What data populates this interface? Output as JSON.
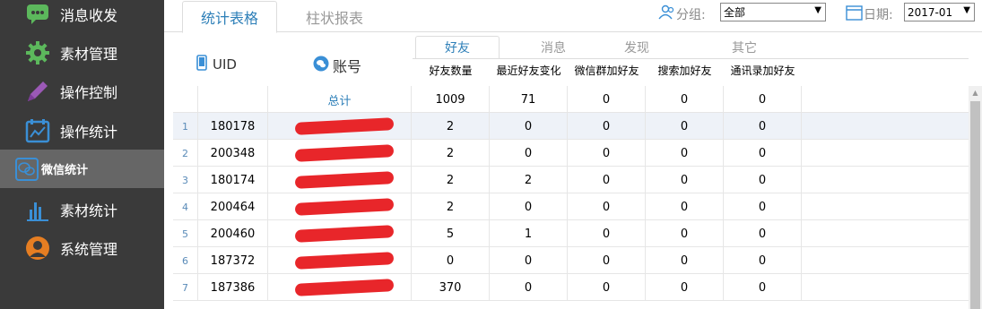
{
  "sidebar": {
    "items": [
      {
        "label": "消息收发",
        "icon": "chat-icon"
      },
      {
        "label": "素材管理",
        "icon": "gear-icon"
      },
      {
        "label": "操作控制",
        "icon": "pencil-icon"
      },
      {
        "label": "操作统计",
        "icon": "calendar-chart-icon"
      },
      {
        "label": "微信统计",
        "icon": "wechat-icon"
      },
      {
        "label": "素材统计",
        "icon": "bar-chart-icon"
      },
      {
        "label": "系统管理",
        "icon": "user-icon"
      }
    ]
  },
  "tabs": [
    {
      "label": "统计表格"
    },
    {
      "label": "柱状报表"
    }
  ],
  "filters": {
    "group_label": "分组:",
    "group_value": "全部",
    "date_label": "日期:",
    "date_value": "2017-01"
  },
  "header": {
    "uid_label": "UID",
    "account_label": "账号",
    "subtabs": [
      {
        "label": "好友"
      },
      {
        "label": "消息"
      },
      {
        "label": "发现"
      },
      {
        "label": "其它"
      }
    ],
    "columns": [
      "好友数量",
      "最近好友变化",
      "微信群加好友",
      "搜索加好友",
      "通讯录加好友"
    ]
  },
  "total": {
    "label": "总计",
    "values": [
      "1009",
      "71",
      "0",
      "0",
      "0"
    ]
  },
  "rows": [
    {
      "idx": "1",
      "uid": "180178",
      "values": [
        "2",
        "0",
        "0",
        "0",
        "0"
      ]
    },
    {
      "idx": "2",
      "uid": "200348",
      "values": [
        "2",
        "0",
        "0",
        "0",
        "0"
      ]
    },
    {
      "idx": "3",
      "uid": "180174",
      "values": [
        "2",
        "2",
        "0",
        "0",
        "0"
      ]
    },
    {
      "idx": "4",
      "uid": "200464",
      "values": [
        "2",
        "0",
        "0",
        "0",
        "0"
      ]
    },
    {
      "idx": "5",
      "uid": "200460",
      "values": [
        "5",
        "1",
        "0",
        "0",
        "0"
      ]
    },
    {
      "idx": "6",
      "uid": "187372",
      "values": [
        "0",
        "0",
        "0",
        "0",
        "0"
      ]
    },
    {
      "idx": "7",
      "uid": "187386",
      "values": [
        "370",
        "0",
        "0",
        "0",
        "0"
      ]
    }
  ],
  "colors": {
    "sidebar_bg": "#3a3a3a",
    "sidebar_active": "#666666",
    "accent": "#2d7fb8",
    "icon_green": "#5cb85c",
    "icon_blue": "#3a8fd6",
    "icon_purple": "#9b59b6",
    "icon_orange": "#e67e22",
    "redaction": "#e8262a"
  }
}
